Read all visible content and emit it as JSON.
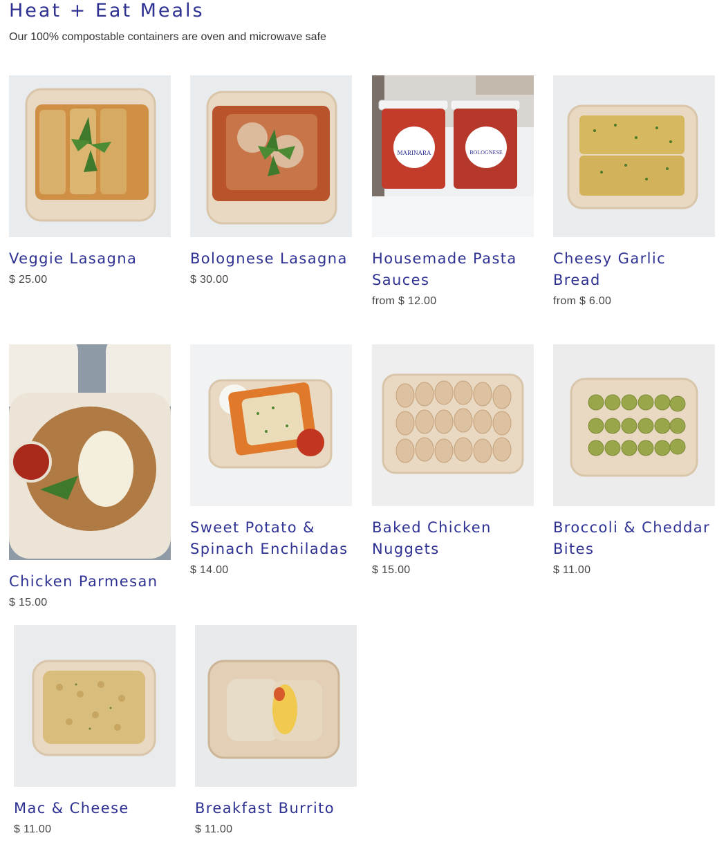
{
  "header": {
    "title": "Heat + Eat Meals",
    "subtitle": "Our 100% compostable containers are oven and microwave safe"
  },
  "products": [
    {
      "name": "Veggie Lasagna",
      "price": "$ 25.00"
    },
    {
      "name": "Bolognese Lasagna",
      "price": "$ 30.00"
    },
    {
      "name": "Housemade Pasta Sauces",
      "price": "from $ 12.00"
    },
    {
      "name": "Cheesy Garlic Bread",
      "price": "from $ 6.00"
    },
    {
      "name": "Chicken Parmesan",
      "price": "$ 15.00"
    },
    {
      "name": "Sweet Potato & Spinach Enchiladas",
      "price": "$ 14.00"
    },
    {
      "name": "Baked Chicken Nuggets",
      "price": "$ 15.00"
    },
    {
      "name": "Broccoli & Cheddar Bites",
      "price": "$ 11.00"
    },
    {
      "name": "Mac & Cheese",
      "price": "$ 11.00"
    },
    {
      "name": "Breakfast Burrito",
      "price": "$ 11.00"
    }
  ],
  "labels": {
    "jar_left": "MARINARA",
    "jar_right": "BOLOGNESE"
  },
  "colors": {
    "brand": "#2e3192",
    "text": "#333333",
    "container": "#e6d6c0"
  }
}
